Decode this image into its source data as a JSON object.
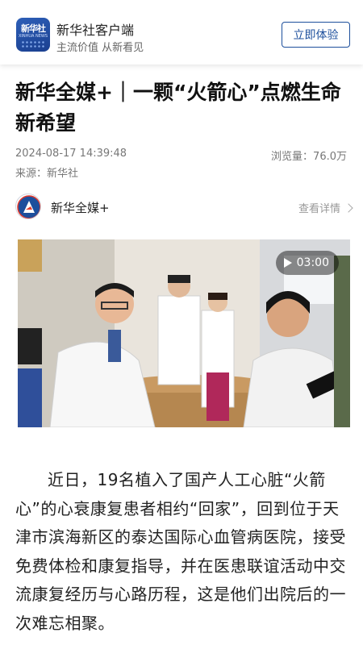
{
  "app": {
    "logo_text_cn": "新华社",
    "logo_text_en": "XINHUA NEWS",
    "name": "新华社客户端",
    "slogan": "主流价值 从新看见",
    "cta_label": "立即体验"
  },
  "article": {
    "title": "新华全媒+｜一颗“火箭心”点燃生命新希望",
    "timestamp": "2024-08-17 14:39:48",
    "views": "浏览量：76.0万",
    "source": "来源：新华社"
  },
  "author": {
    "name": "新华全媒+",
    "detail_link": "查看详情"
  },
  "video": {
    "duration": "03:00"
  },
  "body": {
    "paragraph": "近日，19名植入了国产人工心脏“火箭心”的心衰康复患者相约“回家”，回到位于天津市滨海新区的泰达国际心血管病医院，接受免费体检和康复指导，并在医患联谊活动中交流康复经历与心路历程，这是他们出院后的一次难忘相聚。"
  },
  "colors": {
    "brand_blue": "#1d4f9c",
    "muted_text": "#777777"
  }
}
